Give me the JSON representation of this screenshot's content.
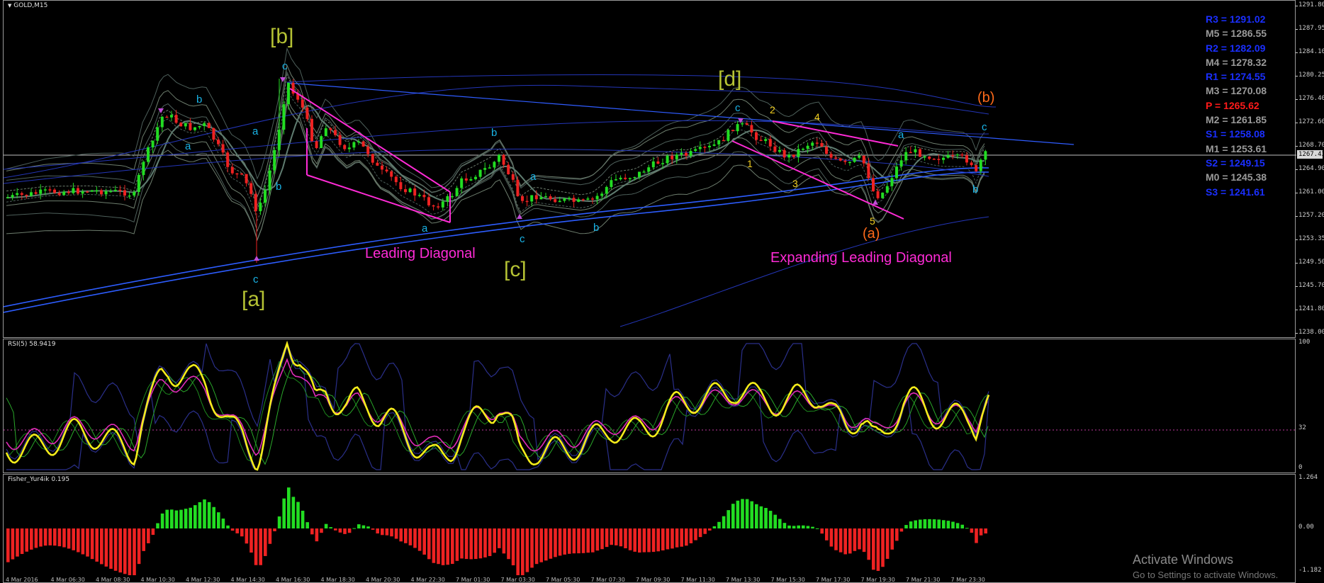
{
  "chart": {
    "symbol_timeframe": "GOLD,M15",
    "y_axis_labels": [
      "1291.80",
      "1287.95",
      "1284.10",
      "1280.25",
      "1276.40",
      "1272.60",
      "1268.70",
      "1264.90",
      "1261.00",
      "1257.20",
      "1253.35",
      "1249.50",
      "1245.70",
      "1241.80",
      "1238.00"
    ],
    "current_price": "1267.43",
    "pivot_levels": [
      {
        "text": "R3 = 1291.02",
        "color": "#1a2fff"
      },
      {
        "text": "M5 = 1286.55",
        "color": "#9a9a9a"
      },
      {
        "text": "R2 = 1282.09",
        "color": "#1a2fff"
      },
      {
        "text": "M4 = 1278.32",
        "color": "#9a9a9a"
      },
      {
        "text": "R1 = 1274.55",
        "color": "#1a2fff"
      },
      {
        "text": "M3 = 1270.08",
        "color": "#9a9a9a"
      },
      {
        "text": "P   = 1265.62",
        "color": "#ff1a1a"
      },
      {
        "text": "M2 = 1261.85",
        "color": "#9a9a9a"
      },
      {
        "text": "S1 = 1258.08",
        "color": "#1a2fff"
      },
      {
        "text": "M1 = 1253.61",
        "color": "#9a9a9a"
      },
      {
        "text": "S2 = 1249.15",
        "color": "#1a2fff"
      },
      {
        "text": "M0 = 1245.38",
        "color": "#9a9a9a"
      },
      {
        "text": "S3 = 1241.61",
        "color": "#1a2fff"
      }
    ],
    "wave_labels": {
      "wa": "[a]",
      "wb": "[b]",
      "wc": "[c]",
      "wd": "[d]",
      "paren_a": "(a)",
      "paren_b": "(b)",
      "lc_a1": "a",
      "lc_b1": "b",
      "lc_c1": "c",
      "lc_a2": "a",
      "lc_b2": "b",
      "lc_c2": "c",
      "lc_a3": "a",
      "lc_b3": "b",
      "lc_c3": "c",
      "lc_a4": "a",
      "lc_b4": "b",
      "lc_c4": "c",
      "lc_a5": "a",
      "lc_b5": "b",
      "lc_c5": "c",
      "lc_a6": "a",
      "lc_b6": "b",
      "lc_c6": "c",
      "n1": "1",
      "n2": "2",
      "n3": "3",
      "n4": "4",
      "n5": "5"
    },
    "annotations": {
      "leading_diagonal": "Leading Diagonal",
      "expanding_leading_diagonal": "Expanding Leading Diagonal"
    },
    "colors": {
      "wave_major": "#b5c234",
      "wave_minor": "#19b3e6",
      "wave_numbers": "#f2cf1f",
      "wave_orange": "#ff6a1a",
      "diagonal": "#ff2bd6",
      "candle_up": "#22dd22",
      "candle_down": "#ee2222"
    }
  },
  "rsi": {
    "title": "RSI(5) 58.9419",
    "axis_labels": [
      "100",
      "32",
      "0"
    ]
  },
  "fisher": {
    "title": "Fisher_Yur4ik 0.195",
    "axis_labels": [
      "1.264",
      "0.00",
      "-1.182"
    ]
  },
  "x_axis_labels": [
    "4 Mar 2016",
    "4 Mar 06:30",
    "4 Mar 08:30",
    "4 Mar 10:30",
    "4 Mar 12:30",
    "4 Mar 14:30",
    "4 Mar 16:30",
    "4 Mar 18:30",
    "4 Mar 20:30",
    "4 Mar 22:30",
    "7 Mar 01:30",
    "7 Mar 03:30",
    "7 Mar 05:30",
    "7 Mar 07:30",
    "7 Mar 09:30",
    "7 Mar 11:30",
    "7 Mar 13:30",
    "7 Mar 15:30",
    "7 Mar 17:30",
    "7 Mar 19:30",
    "7 Mar 21:30",
    "7 Mar 23:30"
  ],
  "watermark": {
    "line1": "Activate Windows",
    "line2": "Go to Settings to activate Windows."
  }
}
